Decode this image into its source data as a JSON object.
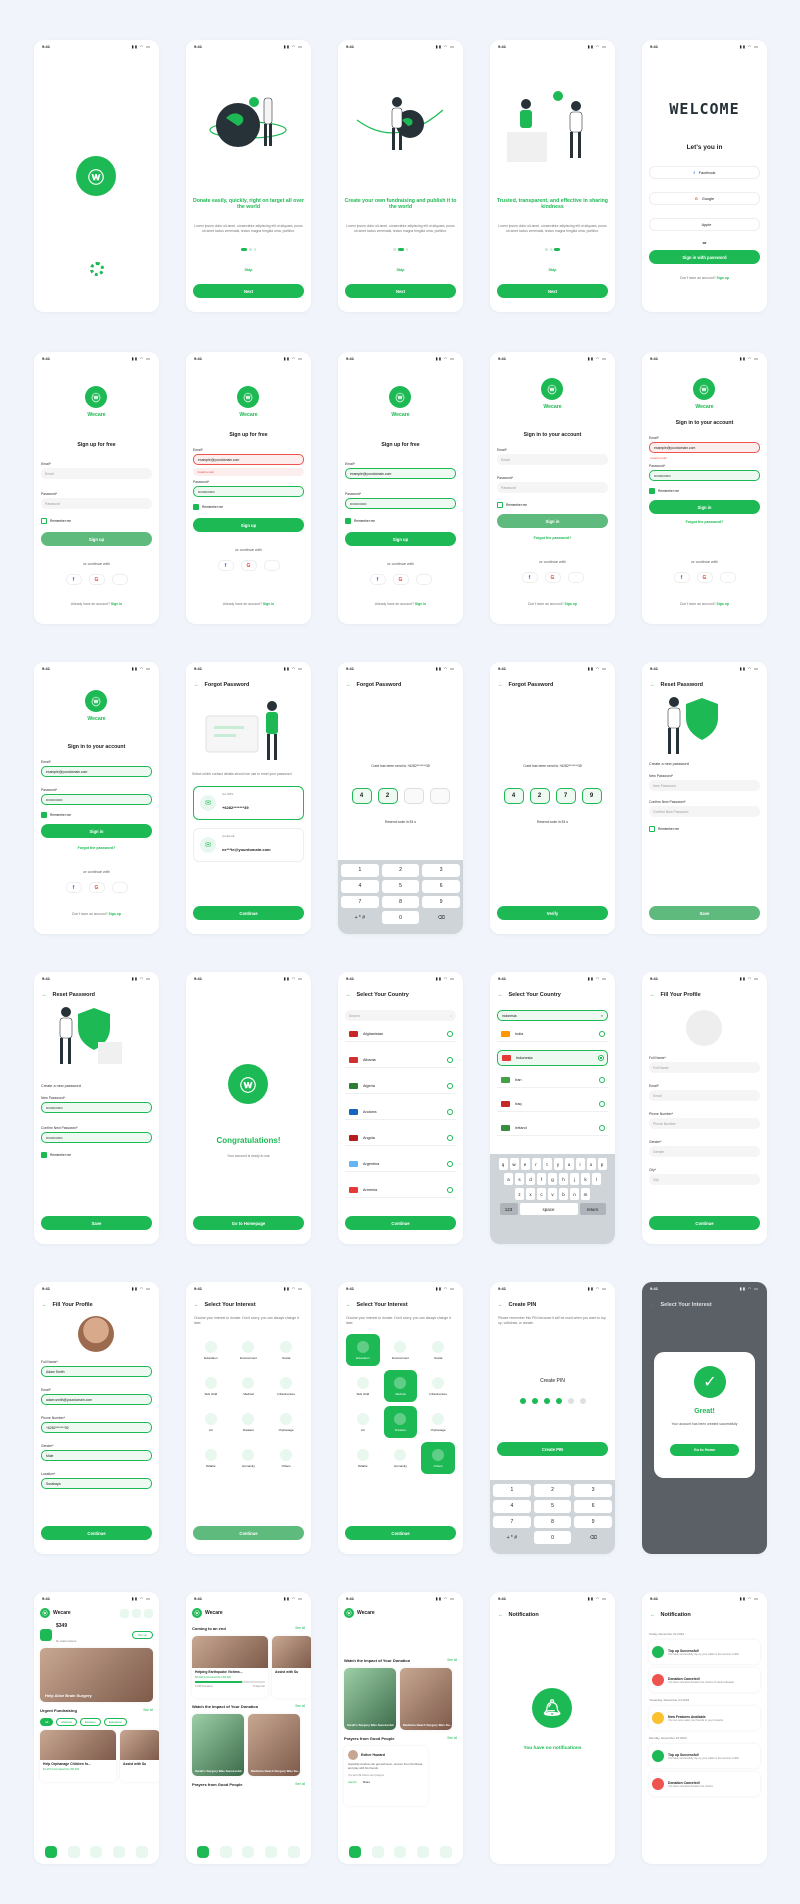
{
  "status": {
    "time": "9:41"
  },
  "onboarding": [
    {
      "title": "Donate easily, quickly, right on target all over the world",
      "body": "Lorem ipsum dolor sit amet, consectetur adipiscing elit ut aliquam, purus sit amet luctus venenatis, lectus magna fringilla urna, porttitor.",
      "skip": "Skip",
      "next": "Next"
    },
    {
      "title": "Create your own fundraising and publish it to the world",
      "body": "Lorem ipsum dolor sit amet, consectetur adipiscing elit ut aliquam, purus sit amet luctus venenatis, lectus magna fringilla urna, porttitor.",
      "skip": "Skip",
      "next": "Next"
    },
    {
      "title": "Trusted, transparent, and effective in sharing kindness",
      "body": "Lorem ipsum dolor sit amet, consectetur adipiscing elit ut aliquam, purus sit amet luctus venenatis, lectus magna fringilla urna, porttitor.",
      "skip": "Skip",
      "next": "Next"
    }
  ],
  "welcome": {
    "art": "WELCOME",
    "title": "Let's you in",
    "facebook": "Facebook",
    "google": "Google",
    "apple": "Apple",
    "or": "or",
    "password_btn": "Sign in with password",
    "no_account": "Don't have an account?",
    "signup": "Sign up"
  },
  "brand": "Wecare",
  "signup": {
    "title": "Sign up for free",
    "email_label": "Email*",
    "email_ph": "Email",
    "email_val": "example@yourdomain.com",
    "pass_label": "Password*",
    "pass_ph": "Password",
    "pass_val": "••••••••••••••",
    "remember": "Remember me",
    "button": "Sign up",
    "continue_with": "or continue with",
    "has_account": "Already have an account?",
    "signin": "Sign in",
    "invalid": "Invalid email"
  },
  "signin": {
    "title": "Sign in to your account",
    "button": "Sign in",
    "forgot": "Forgot the password?",
    "no_account": "Don't have an account?",
    "signup": "Sign up"
  },
  "forgot": {
    "title": "Forgot Password",
    "desc": "Select which contact details should we use to reset your password",
    "via_sms": "via SMS:",
    "phone": "+6282*******39",
    "via_email": "via Email:",
    "email": "ex***le@yourdomain.com",
    "continue": "Continue",
    "sent": "Code has been send to +6282*******39",
    "resend": "Resend code in 53 s",
    "verify": "Verify",
    "digits_a": [
      "4",
      "2",
      "",
      ""
    ],
    "digits_b": [
      "4",
      "2",
      "7",
      "9"
    ]
  },
  "keypad": [
    {
      "n": "1",
      "l": ""
    },
    {
      "n": "2",
      "l": "ABC"
    },
    {
      "n": "3",
      "l": "DEF"
    },
    {
      "n": "4",
      "l": "GHI"
    },
    {
      "n": "5",
      "l": "JKL"
    },
    {
      "n": "6",
      "l": "MNO"
    },
    {
      "n": "7",
      "l": "PQRS"
    },
    {
      "n": "8",
      "l": "TUV"
    },
    {
      "n": "9",
      "l": "WXYZ"
    },
    {
      "n": "+ * #",
      "l": ""
    },
    {
      "n": "0",
      "l": ""
    },
    {
      "n": "⌫",
      "l": ""
    }
  ],
  "reset": {
    "title": "Reset Password",
    "desc": "Create a new password",
    "new_label": "New Password*",
    "new_ph": "New Password",
    "confirm_label": "Confirm New Password*",
    "confirm_ph": "Confirm New Password",
    "remember": "Remember me",
    "save": "Save"
  },
  "congrats": {
    "title": "Congratulations!",
    "body": "Your account is ready to use",
    "button": "Go to Homepage"
  },
  "country": {
    "title": "Select Your Country",
    "search": "Search",
    "typed": "indonesia",
    "continue": "Continue",
    "list": [
      "Afghanistan",
      "Albania",
      "Algeria",
      "Andorra",
      "Angola",
      "Argentina",
      "Armenia"
    ],
    "list2": [
      "India",
      "Indonesia",
      "Iran",
      "Iraq",
      "Ireland"
    ],
    "flags": [
      "#c62828",
      "#d32f2f",
      "#2e7d32",
      "#1565c0",
      "#b71c1c",
      "#64b5f6",
      "#e53935"
    ],
    "flags2": [
      "#ff9800",
      "#e53935",
      "#43a047",
      "#c62828",
      "#388e3c"
    ],
    "keys1": [
      "q",
      "w",
      "e",
      "r",
      "t",
      "y",
      "u",
      "i",
      "o",
      "p"
    ],
    "keys2": [
      "a",
      "s",
      "d",
      "f",
      "g",
      "h",
      "j",
      "k",
      "l"
    ],
    "keys3": [
      "z",
      "x",
      "c",
      "v",
      "b",
      "n",
      "m"
    ],
    "space": "space",
    "return": "return",
    "num": "123"
  },
  "profile": {
    "title": "Fill Your Profile",
    "full_label": "Full Name*",
    "full_ph": "Full Name",
    "full_val": "Adam Smith",
    "email_label": "Email*",
    "email_ph": "Email",
    "email_val": "adam.smith@yourdomain.com",
    "phone_label": "Phone Number*",
    "phone_ph": "Phone Number",
    "phone_val": "+6282*******39",
    "gender_label": "Gender*",
    "gender_ph": "Gender",
    "gender_val": "Male",
    "city_label": "City*",
    "city_ph": "City",
    "location_label": "Location*",
    "location_val": "Surabaya",
    "continue": "Continue"
  },
  "interest": {
    "title": "Select Your Interest",
    "desc": "Choose your interest to donate. Don't worry, you can always change it later.",
    "items": [
      "Education",
      "Environment",
      "Social",
      "Sick child",
      "Medical",
      "Infrastructure",
      "Art",
      "Disaster",
      "Orphanage",
      "Difable",
      "Humanity",
      "Others"
    ],
    "continue": "Continue"
  },
  "pin": {
    "title": "Create PIN",
    "desc": "Please remember this PIN because it will be used when you want to top up, withdraw, or donate.",
    "label": "Create PIN",
    "button": "Create PIN"
  },
  "great": {
    "title": "Great!",
    "body": "Your account has been created successfully",
    "button": "Go to Home"
  },
  "home": {
    "balance": "$349",
    "balance_label": "My wallet balance",
    "topup": "Top up",
    "banner": "Help Alice Brain Surgery",
    "urgent": "Urgent Fundraising",
    "see_all": "See all",
    "chips": [
      "All",
      "Medical",
      "Disaster",
      "Education"
    ],
    "card1": "Help Orphanage Children fo...",
    "card1_amt": "$1,270 fund raised from $5,200",
    "card2": "Assist with Su",
    "coming": "Coming to an end",
    "c1": "Helping Earthquake Victims...",
    "c1_amt": "$2,020 fund raised from $3,000",
    "c1_don": "5,295 Donators",
    "c1_days": "8 days left",
    "c2": "Assist with Su",
    "watch": "Watch the Impact of Your Donation",
    "w1": "Sarah's Surgery Was Successful",
    "w2": "Medicine Reach Surgery Was Su...",
    "prayers": "Prayers from Good People",
    "pray_name": "Esther Howard",
    "pray_text": "Hopefully Andrew can get well soon, recover from his illness, and play with his friends.",
    "pray_who": "You and 49 others sent prayers",
    "amen": "Aamiin",
    "share": "Share"
  },
  "notification": {
    "title": "Notification",
    "empty": "You have no notifications",
    "groups": [
      "Today, December 22 2023",
      "Yesterday, December 24 2023",
      "Monday, December 23 2023"
    ],
    "items": [
      {
        "t": "Top up Successful!",
        "d": "You have successfully top up your wallet in the amount of $20"
      },
      {
        "t": "Donation Canceled!",
        "d": "You have canceled donation for victims of natural disaster"
      },
      {
        "t": "New Features Available",
        "d": "You can now make your friends to your contacts"
      },
      {
        "t": "Top up Successful!",
        "d": "You have successfully top up your wallet in the amount of $20"
      },
      {
        "t": "Donation Canceled!",
        "d": "You have canceled donation for victims"
      }
    ]
  },
  "colors": {
    "primary": "#1db954",
    "error": "#ef5350",
    "bg": "#f1f5fb"
  }
}
